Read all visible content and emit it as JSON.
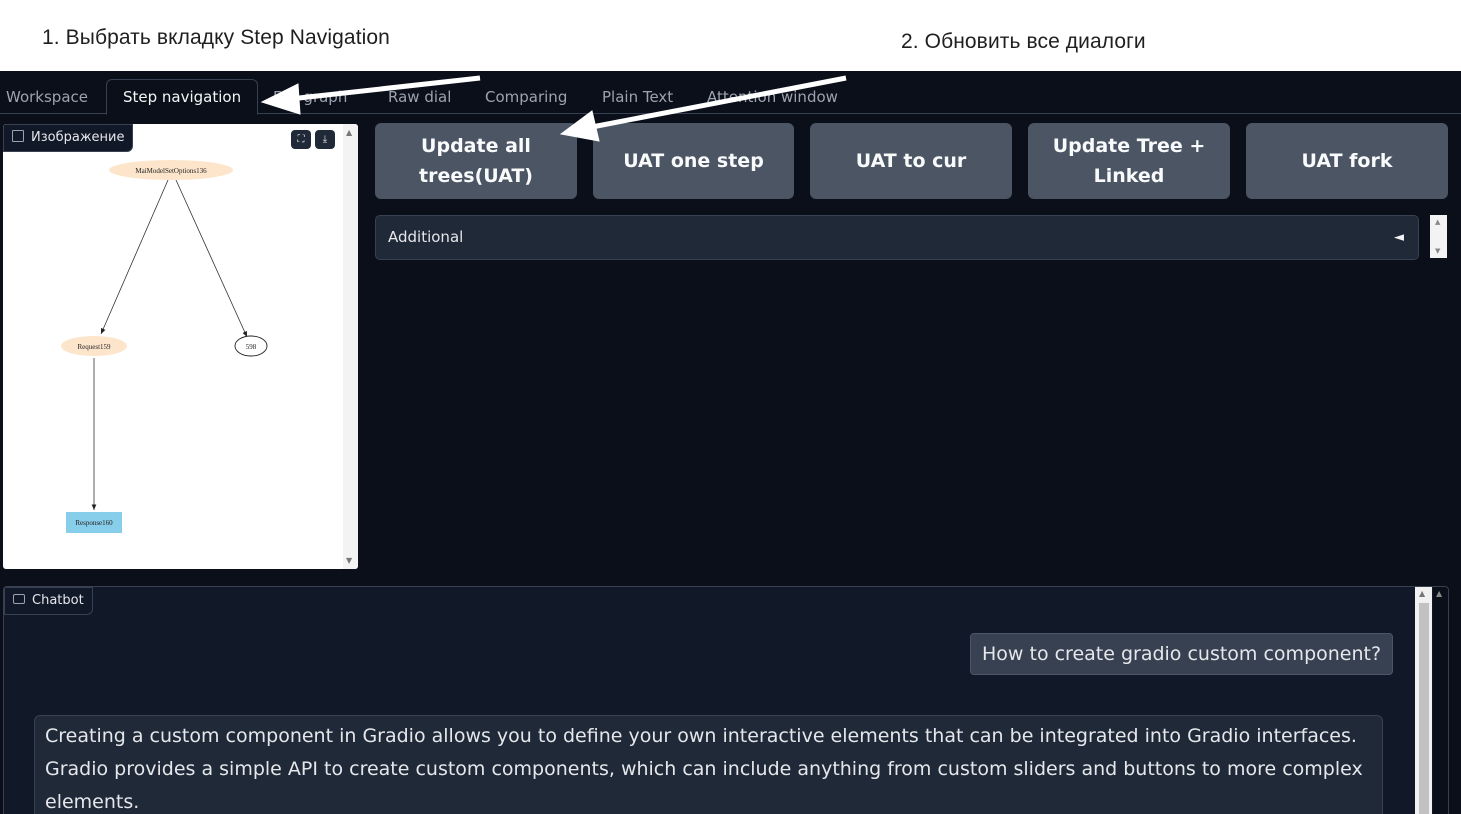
{
  "instructions": {
    "step1": "1. Выбрать вкладку Step Navigation",
    "step2": "2. Обновить все диалоги"
  },
  "tabs": [
    {
      "label": "Workspace",
      "selected": false
    },
    {
      "label": "Step navigation",
      "selected": true
    },
    {
      "label": "Full graph",
      "selected": false
    },
    {
      "label": "Raw dial",
      "selected": false
    },
    {
      "label": "Comparing",
      "selected": false
    },
    {
      "label": "Plain Text",
      "selected": false
    },
    {
      "label": "Attention window",
      "selected": false
    }
  ],
  "image_panel": {
    "label": "Изображение",
    "fullscreen_icon": "fullscreen-icon",
    "download_icon": "download-icon",
    "graph": {
      "nodes": [
        "MaiModelSetOptions136",
        "Request159",
        "598",
        "Response160"
      ]
    }
  },
  "buttons": [
    {
      "label_line1": "Update all",
      "label_line2": "trees(UAT)"
    },
    {
      "label_line1": "UAT one step",
      "label_line2": ""
    },
    {
      "label_line1": "UAT to cur",
      "label_line2": ""
    },
    {
      "label_line1": "Update Tree +",
      "label_line2": "Linked"
    },
    {
      "label_line1": "UAT fork",
      "label_line2": ""
    }
  ],
  "accordion": {
    "label": "Additional",
    "arrow": "◄"
  },
  "chatbot": {
    "label": "Chatbot",
    "user_message": "How to create gradio custom component?",
    "bot_message": "Creating a custom component in Gradio allows you to define your own interactive elements that can be integrated into Gradio interfaces. Gradio provides a simple API to create custom components, which can include anything from custom sliders and buttons to more complex elements."
  },
  "colors": {
    "app_bg": "#0b0f19",
    "button_bg": "#4b5563",
    "panel_bg": "#1f2937"
  }
}
